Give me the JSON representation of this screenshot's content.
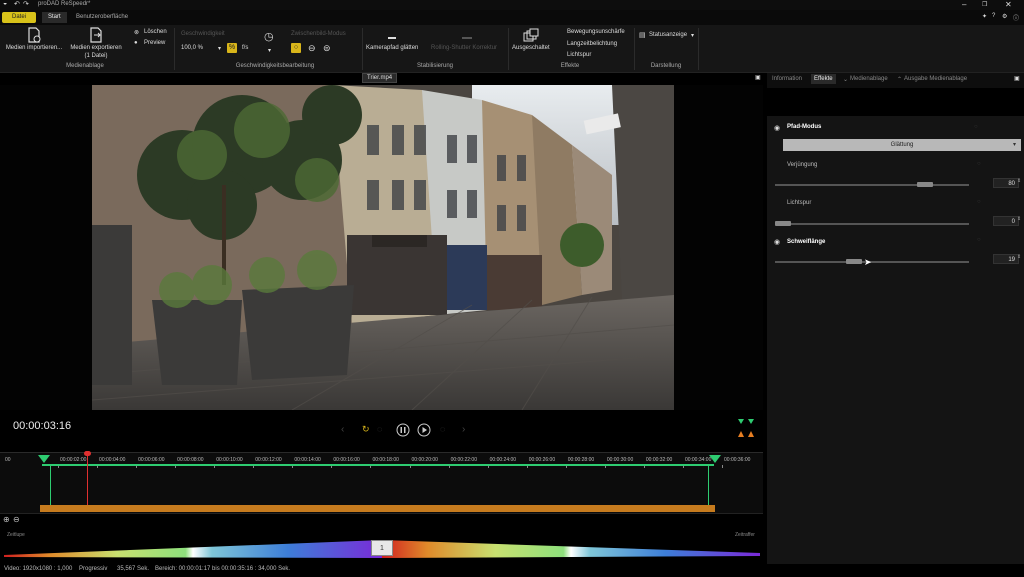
{
  "window": {
    "title": "proDAD ReSpeedr*"
  },
  "tabs": {
    "file": "Datei",
    "start": "Start",
    "ui": "Benutzeroberfläche"
  },
  "ribbon": {
    "import": "Medien importieren...",
    "export": "Medien exportieren",
    "export_sub": "(1 Datei)",
    "delete": "Löschen",
    "preview": "Preview",
    "group_media": "Medienablage",
    "speed_label": "Geschwindigkeit",
    "speed_value": "100,0 %",
    "fps": "f/s",
    "interp_label": "Zwischenbild-Modus",
    "group_speed": "Geschwindigkeitsbearbeitung",
    "cam_smooth": "Kamerapfad glätten",
    "rolling": "Rolling-Shutter Korrektur",
    "group_stab": "Stabilisierung",
    "off": "Ausgeschaltet",
    "motion_blur": "Bewegungsunschärfe",
    "long_exposure": "Langzeitbelichtung",
    "light_trail": "Lichtspur",
    "group_effects": "Effekte",
    "status_display": "Statusanzeige",
    "group_display": "Darstellung",
    "tooltip": "Trier.mp4"
  },
  "right_panel": {
    "tabs": [
      "Information",
      "Effekte",
      "Medienablage",
      "Ausgabe Medienablage"
    ],
    "path_mode": "Pfad-Modus",
    "smoothing": "Glättung",
    "tapering": "Verjüngung",
    "tapering_value": "80",
    "tapering_level": 0.8,
    "light_trail": "Lichtspur",
    "light_trail_value": "0",
    "trail_length": "Schweiflänge",
    "trail_length_value": "19",
    "trail_length_level": 0.4
  },
  "player": {
    "timecode": "00:00:03:16"
  },
  "timeline": {
    "ticks": [
      "00:00:02:00",
      "00:00:04:00",
      "00:00:06:00",
      "00:00:08:00",
      "00:00:10:00",
      "00:00:12:00",
      "00:00:14:00",
      "00:00:16:00",
      "00:00:18:00",
      "00:00:20:00",
      "00:00:22:00",
      "00:00:24:00",
      "00:00:26:00",
      "00:00:28:00",
      "00:00:30:00",
      "00:00:32:00",
      "00:00:34:00",
      "00:00:36:00"
    ],
    "start_tick": "00",
    "timelapse": "Zeitlupe",
    "timelapse_right": "Zeitraffer",
    "speed_center": "1"
  },
  "status": {
    "video": "Video: 1920x1080 : 1,000",
    "scan": "Progressiv",
    "duration": "35,567 Sek.",
    "range": "Bereich: 00:00:01:17 bis 00:00:35:16 : 34,000 Sek."
  }
}
